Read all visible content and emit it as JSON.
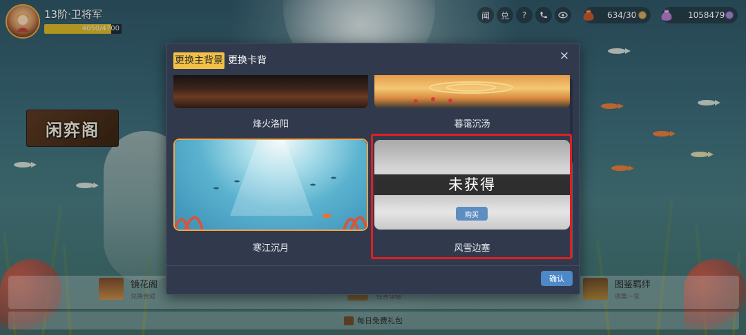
{
  "player": {
    "rank_title": "13阶·卫将军",
    "exp_text": "4050/4700",
    "exp_progress": 0.862
  },
  "hud": {
    "icons": [
      "闻",
      "兑",
      "?"
    ],
    "resource_1": {
      "value": "634/30"
    },
    "resource_2": {
      "value": "1058479"
    }
  },
  "side_banner": {
    "label": "闲弈阁"
  },
  "bottom": {
    "left": {
      "title": "镜花阁",
      "subtitle": "兑换合成"
    },
    "middle": {
      "subtitle": "任务详细"
    },
    "right": {
      "title": "图鉴羁绊",
      "subtitle": "收集一览"
    },
    "gift": "每日免费礼包"
  },
  "modal": {
    "close_label": "×",
    "tabs": [
      {
        "label": "更换主背景",
        "active": true
      },
      {
        "label": "更换卡背",
        "active": false
      }
    ],
    "cards": [
      {
        "label": "烽火洛阳",
        "owned": true,
        "selected": false
      },
      {
        "label": "暮霭沉汤",
        "owned": true,
        "selected": false
      },
      {
        "label": "寒江沉月",
        "owned": true,
        "selected": true
      },
      {
        "label": "风雪边塞",
        "owned": false,
        "selected": false,
        "overlay": "未获得",
        "buy_label": "购买",
        "highlighted": true
      }
    ],
    "confirm_label": "确认"
  },
  "colors": {
    "tab_active": "#f1c046",
    "modal_bg": "#313a4d",
    "confirm": "#4d88c7",
    "highlight": "#e02020",
    "selected_border": "#f1a54a"
  }
}
